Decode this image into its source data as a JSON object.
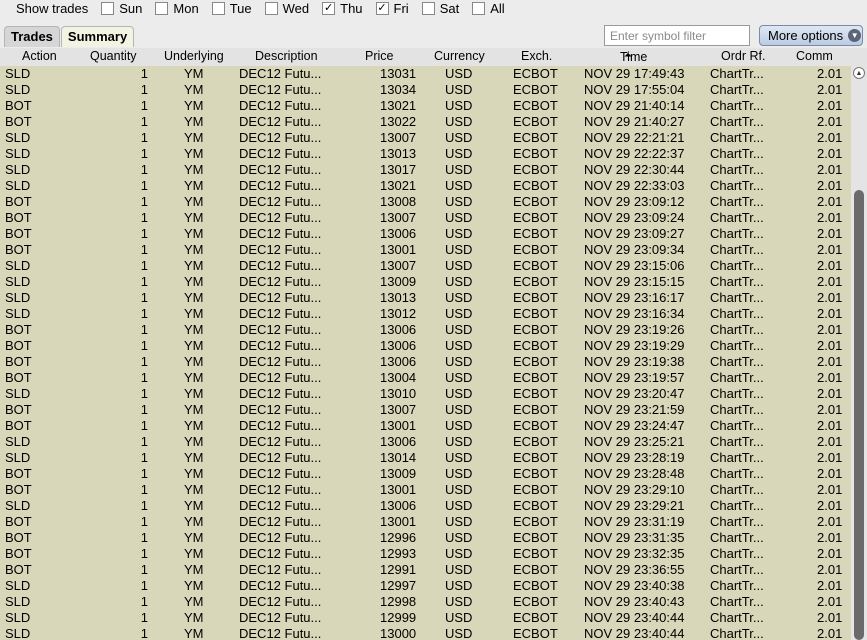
{
  "toolbar": {
    "show_trades_label": "Show trades",
    "days": [
      {
        "label": "Sun",
        "checked": false
      },
      {
        "label": "Mon",
        "checked": false
      },
      {
        "label": "Tue",
        "checked": false
      },
      {
        "label": "Wed",
        "checked": false
      },
      {
        "label": "Thu",
        "checked": true
      },
      {
        "label": "Fri",
        "checked": true
      },
      {
        "label": "Sat",
        "checked": false
      },
      {
        "label": "All",
        "checked": false
      }
    ],
    "check_glyph": "✓"
  },
  "tabs": [
    {
      "label": "Trades",
      "active": false
    },
    {
      "label": "Summary",
      "active": true
    }
  ],
  "filter": {
    "placeholder": "Enter symbol filter",
    "value": ""
  },
  "more_options": {
    "label": "More options",
    "icon": "chevron-down-icon",
    "glyph": "▼"
  },
  "columns": {
    "action": "Action",
    "quantity": "Quantity",
    "underlying": "Underlying",
    "description": "Description",
    "price": "Price",
    "currency": "Currency",
    "exch": "Exch.",
    "time": "Time",
    "ordr_rf": "Ordr Rf.",
    "comm": "Comm"
  },
  "sort_icon_glyph": "⏶",
  "scroll_up_glyph": "▲",
  "rows": [
    [
      "SLD",
      "1",
      "YM",
      "DEC12 Futu...",
      "13031",
      "USD",
      "ECBOT",
      "NOV 29 17:49:43",
      "ChartTr...",
      "2.01"
    ],
    [
      "SLD",
      "1",
      "YM",
      "DEC12 Futu...",
      "13034",
      "USD",
      "ECBOT",
      "NOV 29 17:55:04",
      "ChartTr...",
      "2.01"
    ],
    [
      "BOT",
      "1",
      "YM",
      "DEC12 Futu...",
      "13021",
      "USD",
      "ECBOT",
      "NOV 29 21:40:14",
      "ChartTr...",
      "2.01"
    ],
    [
      "BOT",
      "1",
      "YM",
      "DEC12 Futu...",
      "13022",
      "USD",
      "ECBOT",
      "NOV 29 21:40:27",
      "ChartTr...",
      "2.01"
    ],
    [
      "SLD",
      "1",
      "YM",
      "DEC12 Futu...",
      "13007",
      "USD",
      "ECBOT",
      "NOV 29 22:21:21",
      "ChartTr...",
      "2.01"
    ],
    [
      "SLD",
      "1",
      "YM",
      "DEC12 Futu...",
      "13013",
      "USD",
      "ECBOT",
      "NOV 29 22:22:37",
      "ChartTr...",
      "2.01"
    ],
    [
      "SLD",
      "1",
      "YM",
      "DEC12 Futu...",
      "13017",
      "USD",
      "ECBOT",
      "NOV 29 22:30:44",
      "ChartTr...",
      "2.01"
    ],
    [
      "SLD",
      "1",
      "YM",
      "DEC12 Futu...",
      "13021",
      "USD",
      "ECBOT",
      "NOV 29 22:33:03",
      "ChartTr...",
      "2.01"
    ],
    [
      "BOT",
      "1",
      "YM",
      "DEC12 Futu...",
      "13008",
      "USD",
      "ECBOT",
      "NOV 29 23:09:12",
      "ChartTr...",
      "2.01"
    ],
    [
      "BOT",
      "1",
      "YM",
      "DEC12 Futu...",
      "13007",
      "USD",
      "ECBOT",
      "NOV 29 23:09:24",
      "ChartTr...",
      "2.01"
    ],
    [
      "BOT",
      "1",
      "YM",
      "DEC12 Futu...",
      "13006",
      "USD",
      "ECBOT",
      "NOV 29 23:09:27",
      "ChartTr...",
      "2.01"
    ],
    [
      "BOT",
      "1",
      "YM",
      "DEC12 Futu...",
      "13001",
      "USD",
      "ECBOT",
      "NOV 29 23:09:34",
      "ChartTr...",
      "2.01"
    ],
    [
      "SLD",
      "1",
      "YM",
      "DEC12 Futu...",
      "13007",
      "USD",
      "ECBOT",
      "NOV 29 23:15:06",
      "ChartTr...",
      "2.01"
    ],
    [
      "SLD",
      "1",
      "YM",
      "DEC12 Futu...",
      "13009",
      "USD",
      "ECBOT",
      "NOV 29 23:15:15",
      "ChartTr...",
      "2.01"
    ],
    [
      "SLD",
      "1",
      "YM",
      "DEC12 Futu...",
      "13013",
      "USD",
      "ECBOT",
      "NOV 29 23:16:17",
      "ChartTr...",
      "2.01"
    ],
    [
      "SLD",
      "1",
      "YM",
      "DEC12 Futu...",
      "13012",
      "USD",
      "ECBOT",
      "NOV 29 23:16:34",
      "ChartTr...",
      "2.01"
    ],
    [
      "BOT",
      "1",
      "YM",
      "DEC12 Futu...",
      "13006",
      "USD",
      "ECBOT",
      "NOV 29 23:19:26",
      "ChartTr...",
      "2.01"
    ],
    [
      "BOT",
      "1",
      "YM",
      "DEC12 Futu...",
      "13006",
      "USD",
      "ECBOT",
      "NOV 29 23:19:29",
      "ChartTr...",
      "2.01"
    ],
    [
      "BOT",
      "1",
      "YM",
      "DEC12 Futu...",
      "13006",
      "USD",
      "ECBOT",
      "NOV 29 23:19:38",
      "ChartTr...",
      "2.01"
    ],
    [
      "BOT",
      "1",
      "YM",
      "DEC12 Futu...",
      "13004",
      "USD",
      "ECBOT",
      "NOV 29 23:19:57",
      "ChartTr...",
      "2.01"
    ],
    [
      "SLD",
      "1",
      "YM",
      "DEC12 Futu...",
      "13010",
      "USD",
      "ECBOT",
      "NOV 29 23:20:47",
      "ChartTr...",
      "2.01"
    ],
    [
      "BOT",
      "1",
      "YM",
      "DEC12 Futu...",
      "13007",
      "USD",
      "ECBOT",
      "NOV 29 23:21:59",
      "ChartTr...",
      "2.01"
    ],
    [
      "BOT",
      "1",
      "YM",
      "DEC12 Futu...",
      "13001",
      "USD",
      "ECBOT",
      "NOV 29 23:24:47",
      "ChartTr...",
      "2.01"
    ],
    [
      "SLD",
      "1",
      "YM",
      "DEC12 Futu...",
      "13006",
      "USD",
      "ECBOT",
      "NOV 29 23:25:21",
      "ChartTr...",
      "2.01"
    ],
    [
      "SLD",
      "1",
      "YM",
      "DEC12 Futu...",
      "13014",
      "USD",
      "ECBOT",
      "NOV 29 23:28:19",
      "ChartTr...",
      "2.01"
    ],
    [
      "BOT",
      "1",
      "YM",
      "DEC12 Futu...",
      "13009",
      "USD",
      "ECBOT",
      "NOV 29 23:28:48",
      "ChartTr...",
      "2.01"
    ],
    [
      "BOT",
      "1",
      "YM",
      "DEC12 Futu...",
      "13001",
      "USD",
      "ECBOT",
      "NOV 29 23:29:10",
      "ChartTr...",
      "2.01"
    ],
    [
      "SLD",
      "1",
      "YM",
      "DEC12 Futu...",
      "13006",
      "USD",
      "ECBOT",
      "NOV 29 23:29:21",
      "ChartTr...",
      "2.01"
    ],
    [
      "BOT",
      "1",
      "YM",
      "DEC12 Futu...",
      "13001",
      "USD",
      "ECBOT",
      "NOV 29 23:31:19",
      "ChartTr...",
      "2.01"
    ],
    [
      "BOT",
      "1",
      "YM",
      "DEC12 Futu...",
      "12996",
      "USD",
      "ECBOT",
      "NOV 29 23:31:35",
      "ChartTr...",
      "2.01"
    ],
    [
      "BOT",
      "1",
      "YM",
      "DEC12 Futu...",
      "12993",
      "USD",
      "ECBOT",
      "NOV 29 23:32:35",
      "ChartTr...",
      "2.01"
    ],
    [
      "BOT",
      "1",
      "YM",
      "DEC12 Futu...",
      "12991",
      "USD",
      "ECBOT",
      "NOV 29 23:36:55",
      "ChartTr...",
      "2.01"
    ],
    [
      "SLD",
      "1",
      "YM",
      "DEC12 Futu...",
      "12997",
      "USD",
      "ECBOT",
      "NOV 29 23:40:38",
      "ChartTr...",
      "2.01"
    ],
    [
      "SLD",
      "1",
      "YM",
      "DEC12 Futu...",
      "12998",
      "USD",
      "ECBOT",
      "NOV 29 23:40:43",
      "ChartTr...",
      "2.01"
    ],
    [
      "SLD",
      "1",
      "YM",
      "DEC12 Futu...",
      "12999",
      "USD",
      "ECBOT",
      "NOV 29 23:40:44",
      "ChartTr...",
      "2.01"
    ],
    [
      "SLD",
      "1",
      "YM",
      "DEC12 Futu...",
      "13000",
      "USD",
      "ECBOT",
      "NOV 29 23:40:44",
      "ChartTr...",
      "2.01"
    ]
  ],
  "colors": {
    "grid_background": "#d8d7b9",
    "header_background": "#e3e3e3",
    "window_background": "#ececec",
    "scroll_thumb": "#6a6a6a"
  }
}
